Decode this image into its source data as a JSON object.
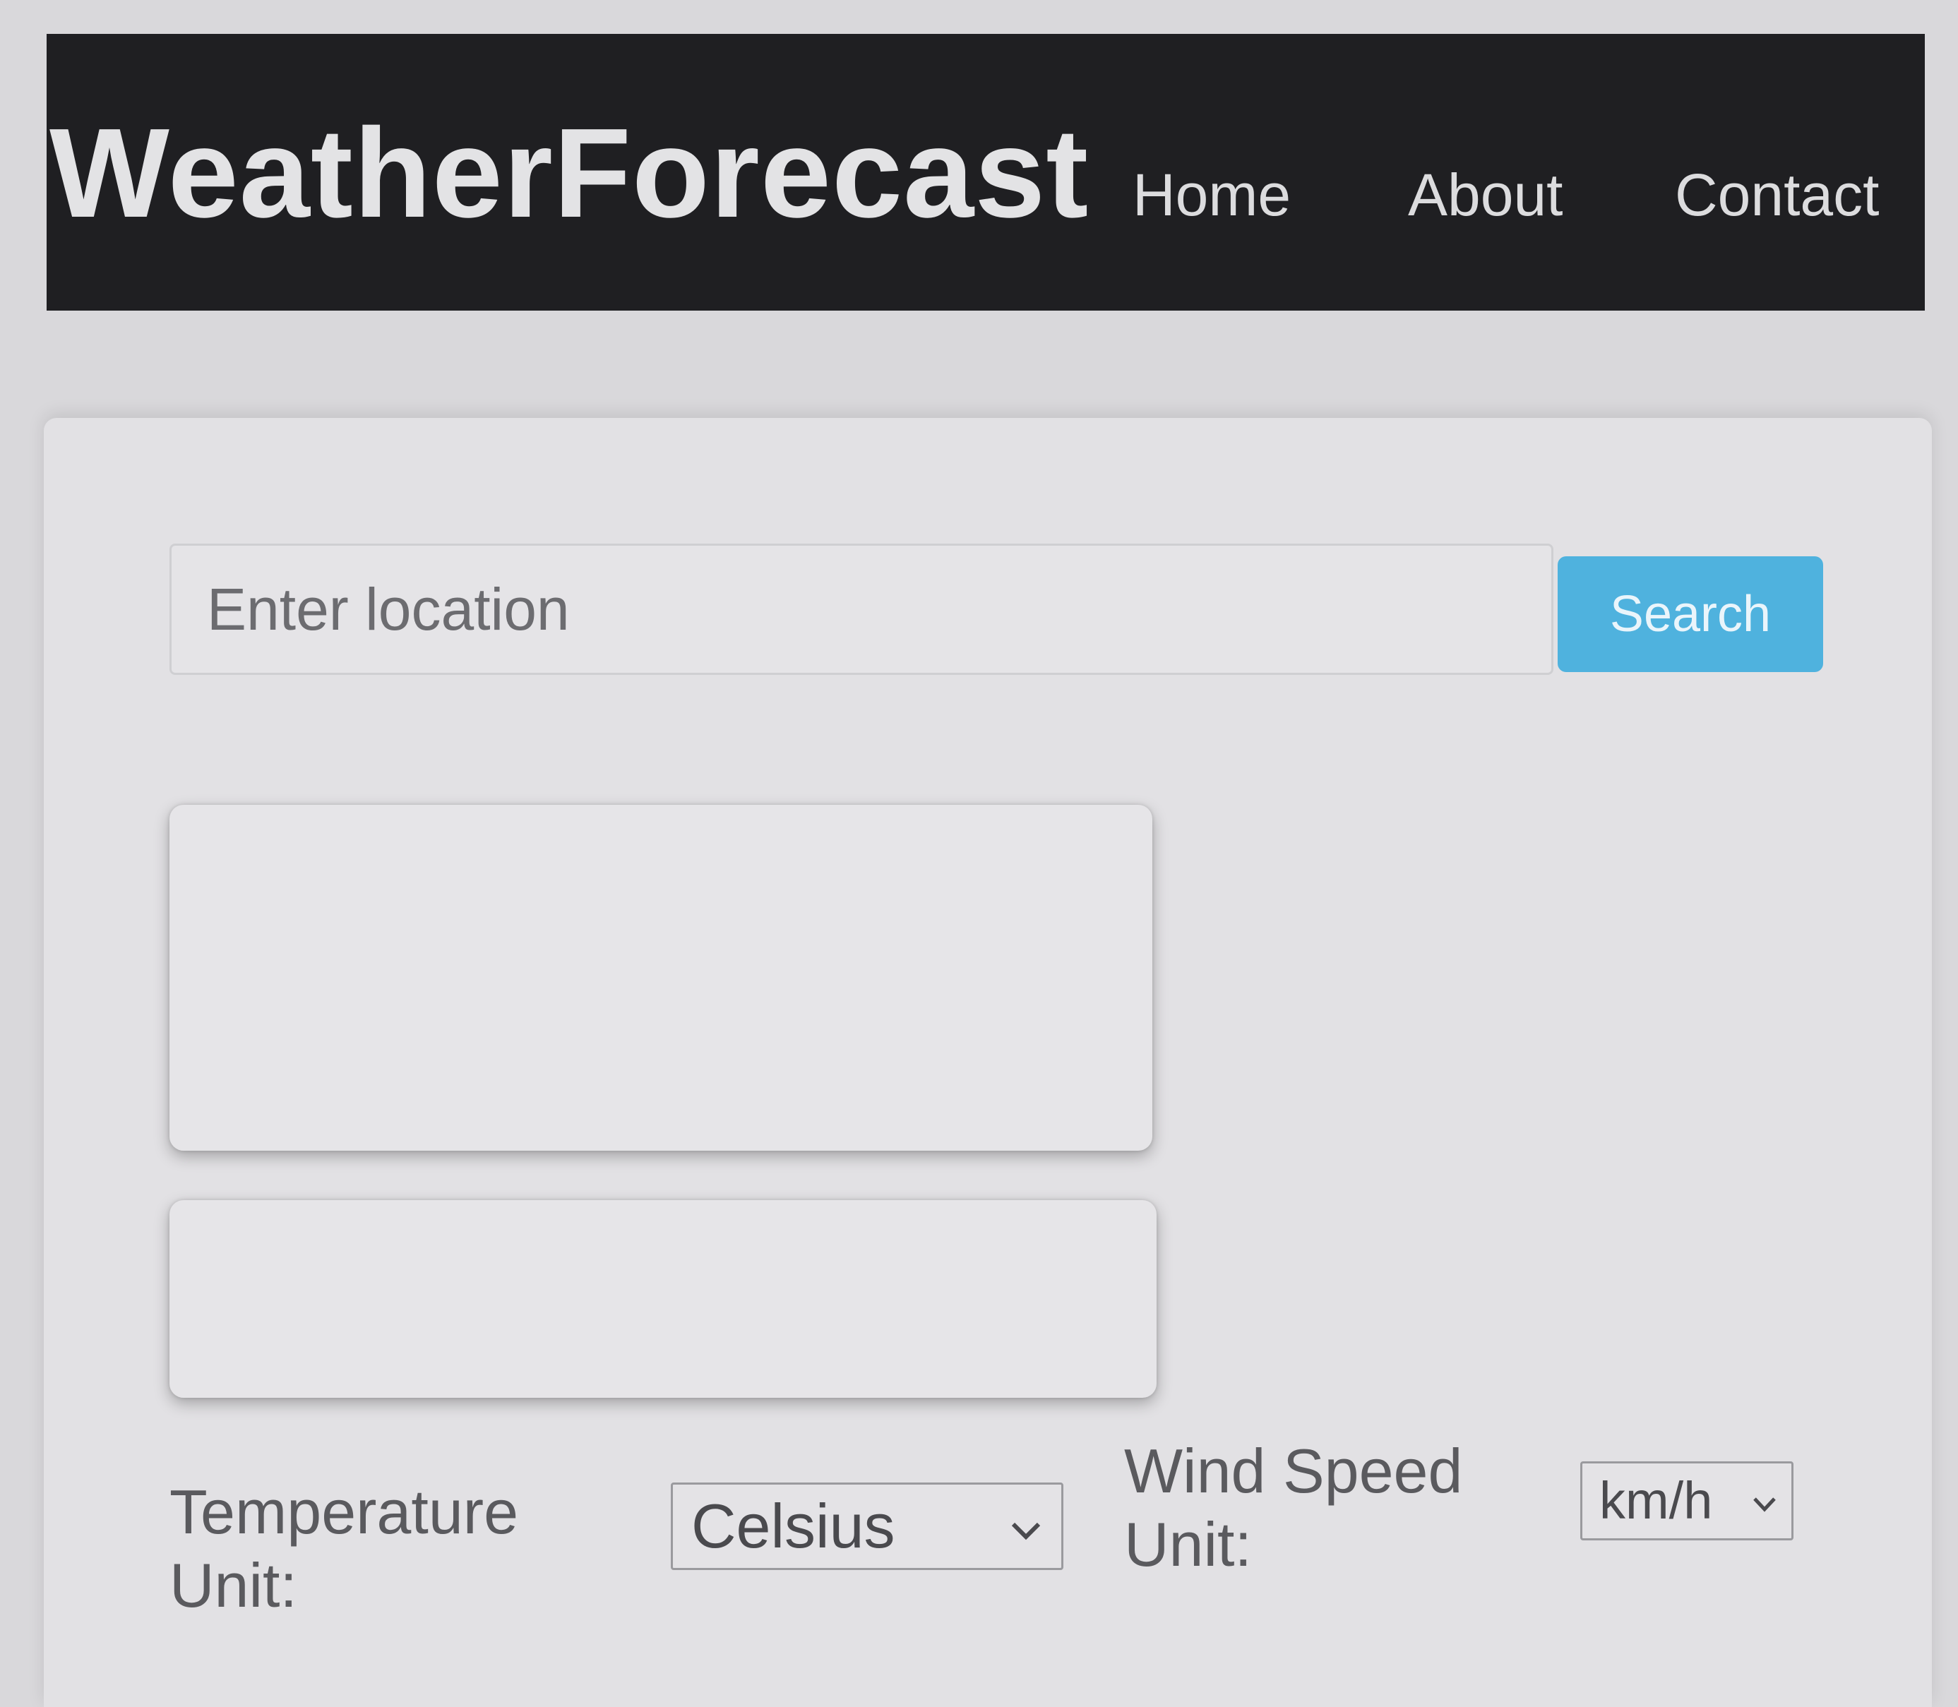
{
  "header": {
    "brand": "WeatherForecast",
    "nav": {
      "home": "Home",
      "about": "About",
      "contact": "Contact"
    }
  },
  "search": {
    "placeholder": "Enter location",
    "value": "",
    "button_label": "Search"
  },
  "units": {
    "temperature_label": "Temperature Unit:",
    "temperature_selected": "Celsius",
    "wind_label": "Wind Speed Unit:",
    "wind_selected": "km/h"
  },
  "icons": {
    "temperature_dropdown": "chevron-down-icon",
    "wind_dropdown": "chevron-down-icon"
  },
  "colors": {
    "header_background": "#1f1f22",
    "search_button": "#4fb2de",
    "page_background": "#d9d8db"
  }
}
